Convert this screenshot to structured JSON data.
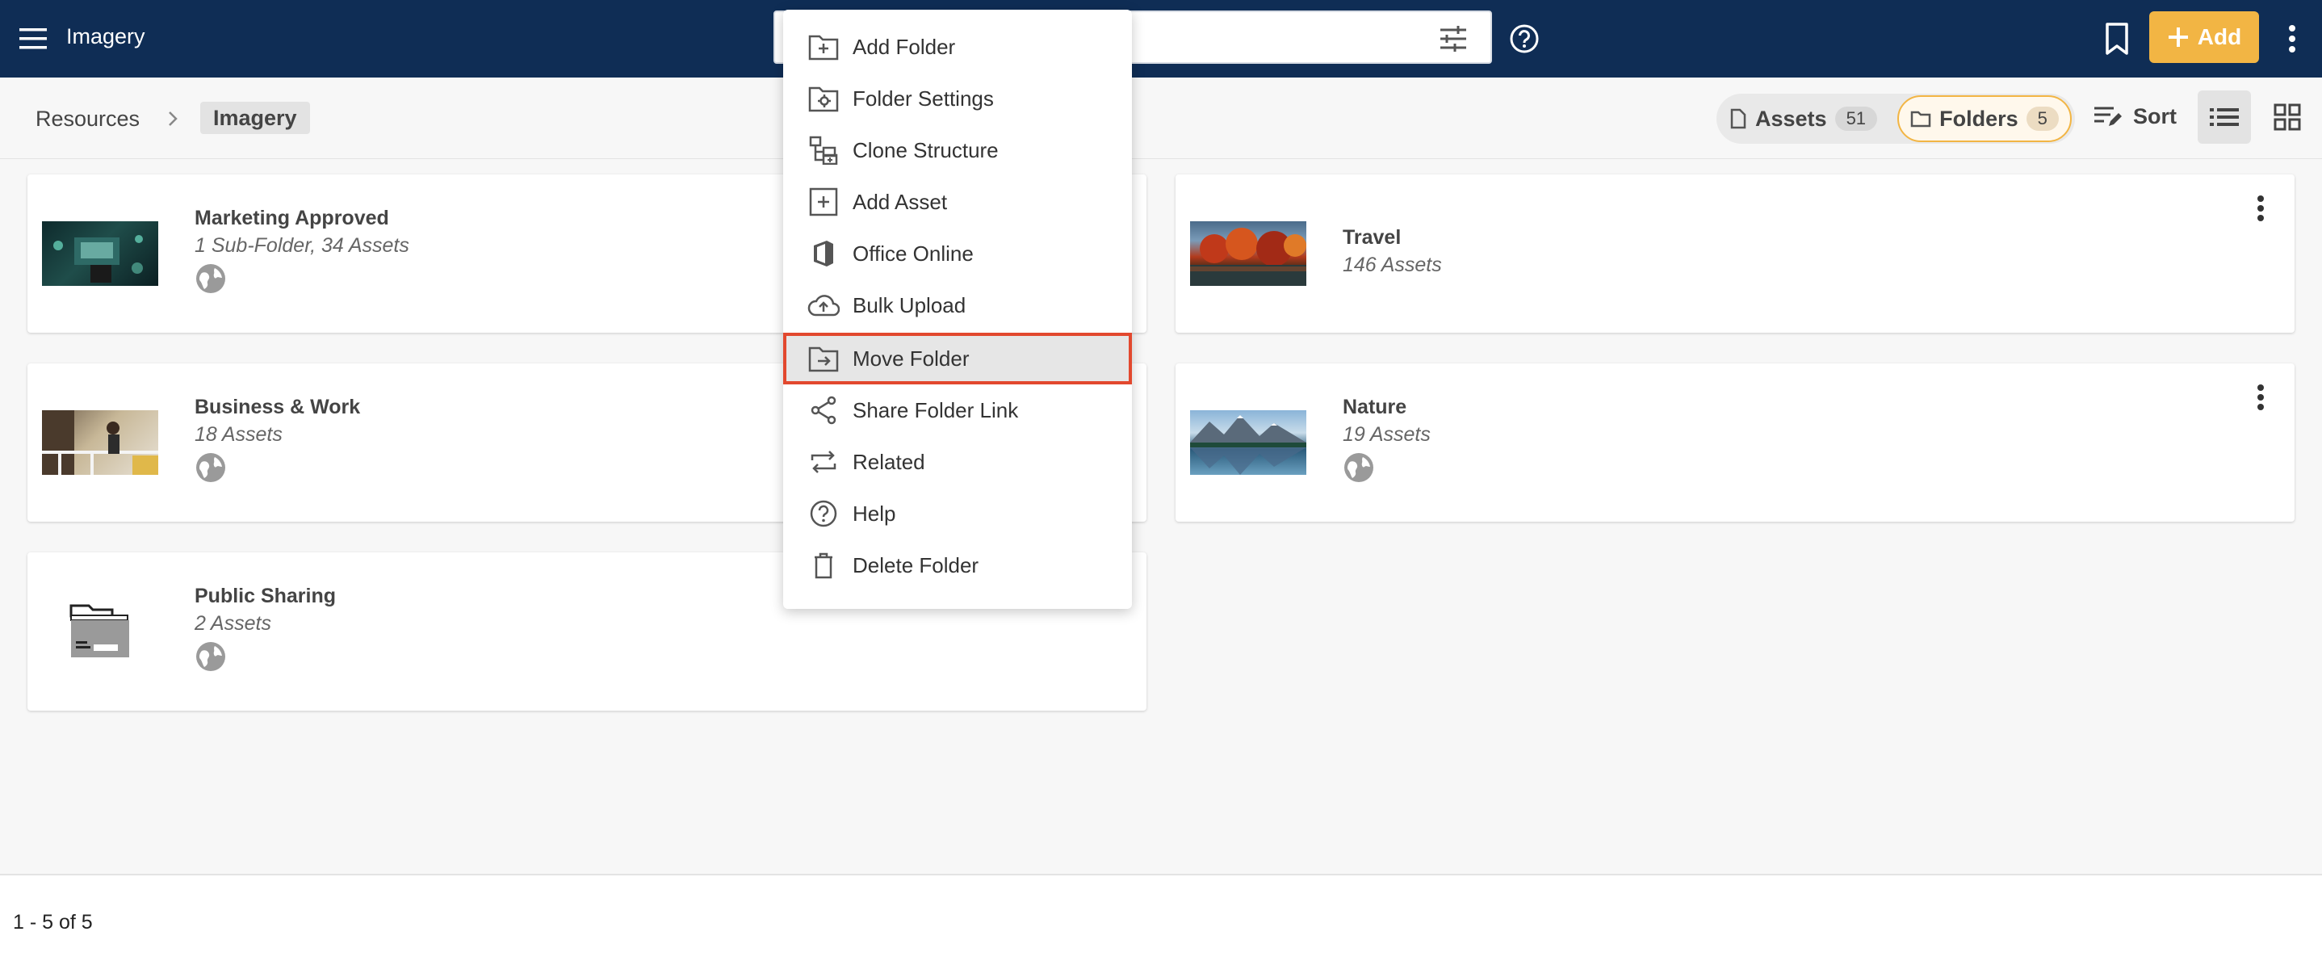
{
  "header": {
    "app_title": "Imagery",
    "search_placeholder": "",
    "add_label": "Add"
  },
  "breadcrumb": {
    "root": "Resources",
    "current": "Imagery"
  },
  "toolbar": {
    "assets_label": "Assets",
    "assets_count": "51",
    "folders_label": "Folders",
    "folders_count": "5",
    "sort_label": "Sort"
  },
  "folders": [
    {
      "title": "Marketing Approved",
      "subtitle": "1 Sub-Folder, 34 Assets"
    },
    {
      "title": "Travel",
      "subtitle": "146 Assets"
    },
    {
      "title": "Business & Work",
      "subtitle": "18 Assets"
    },
    {
      "title": "Nature",
      "subtitle": "19 Assets"
    },
    {
      "title": "Public Sharing",
      "subtitle": "2 Assets"
    }
  ],
  "context_menu": {
    "items": [
      {
        "label": "Add Folder",
        "icon": "folder-plus-icon"
      },
      {
        "label": "Folder Settings",
        "icon": "folder-gear-icon"
      },
      {
        "label": "Clone Structure",
        "icon": "clone-structure-icon"
      },
      {
        "label": "Add Asset",
        "icon": "add-box-icon"
      },
      {
        "label": "Office Online",
        "icon": "office-icon"
      },
      {
        "label": "Bulk Upload",
        "icon": "cloud-upload-icon"
      },
      {
        "label": "Move Folder",
        "icon": "folder-move-icon"
      },
      {
        "label": "Share Folder Link",
        "icon": "share-icon"
      },
      {
        "label": "Related",
        "icon": "related-arrows-icon"
      },
      {
        "label": "Help",
        "icon": "help-circle-icon"
      },
      {
        "label": "Delete Folder",
        "icon": "trash-icon"
      }
    ],
    "highlighted": "Move Folder"
  },
  "footer": {
    "pagination": "1 - 5 of 5"
  },
  "colors": {
    "header_bg": "#0f2d55",
    "accent": "#f2b544",
    "highlight_border": "#e2482e"
  }
}
